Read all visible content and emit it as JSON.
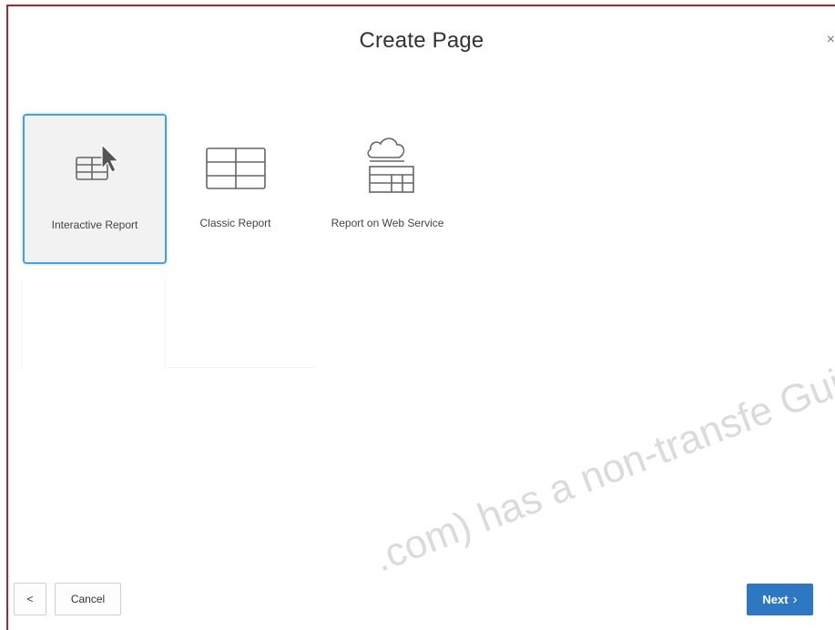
{
  "dialog": {
    "title": "Create Page",
    "close_glyph": "×"
  },
  "options": [
    {
      "label": "Interactive Report",
      "icon": "interactive-report-icon",
      "selected": true
    },
    {
      "label": "Classic Report",
      "icon": "classic-report-icon",
      "selected": false
    },
    {
      "label": "Report on Web Service",
      "icon": "web-service-report-icon",
      "selected": false
    }
  ],
  "footer": {
    "back_glyph": "<",
    "cancel_label": "Cancel",
    "next_label": "Next",
    "next_glyph": "›"
  },
  "colors": {
    "accent": "#2e78c3",
    "selection_border": "#4a9fe0",
    "frame_border": "#a8282c"
  },
  "watermark": ".com) has a non-transfe Guide."
}
